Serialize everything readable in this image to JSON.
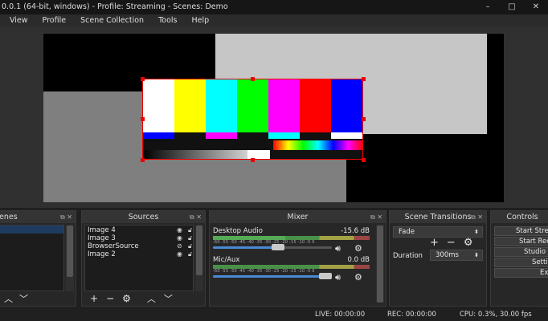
{
  "window": {
    "title": "0.0.1 (64-bit, windows) - Profile: Streaming - Scenes: Demo",
    "controls": [
      "–",
      "□",
      "✕"
    ]
  },
  "menu": [
    "View",
    "Profile",
    "Scene Collection",
    "Tools",
    "Help"
  ],
  "docks": {
    "scenes": {
      "title": "enes",
      "tools": [
        "^",
        "v"
      ]
    },
    "sources": {
      "title": "Sources",
      "items": [
        {
          "name": "Image 4",
          "visible_icon": "eye-icon",
          "lock_icon": "lock-icon"
        },
        {
          "name": "Image 3",
          "visible_icon": "eye-icon",
          "lock_icon": "lock-icon"
        },
        {
          "name": "BrowserSource",
          "visible_icon": "eye-slash-icon",
          "lock_icon": "lock-icon"
        },
        {
          "name": "Image 2",
          "visible_icon": "eye-icon",
          "lock_icon": "lock-icon"
        }
      ],
      "tools": [
        "+",
        "−",
        "⚙",
        "^",
        "v"
      ]
    },
    "mixer": {
      "title": "Mixer",
      "channels": [
        {
          "name": "Desktop Audio",
          "db": "-15.6 dB",
          "level": 0.46,
          "volume": 0.55
        },
        {
          "name": "Mic/Aux",
          "db": "0.0 dB",
          "level": 0.0,
          "volume": 1.0
        }
      ],
      "ticks": "-60 -55 -50 -45 -40 -35 -30 -25 -20 -15 -10 -5 0"
    },
    "transitions": {
      "title": "Scene Transitions",
      "selected": "Fade",
      "duration_label": "Duration",
      "duration_value": "300ms"
    },
    "controls": {
      "title": "Controls",
      "buttons": [
        "Start Stre",
        "Start Rec",
        "Studio M",
        "Settin",
        "Exit"
      ]
    }
  },
  "status": {
    "live": "LIVE: 00:00:00",
    "rec": "REC: 00:00:00",
    "cpu": "CPU: 0.3%, 30.00 fps"
  },
  "colors": {
    "selection": "#e00000",
    "scene_selected": "#1e3a5f"
  }
}
